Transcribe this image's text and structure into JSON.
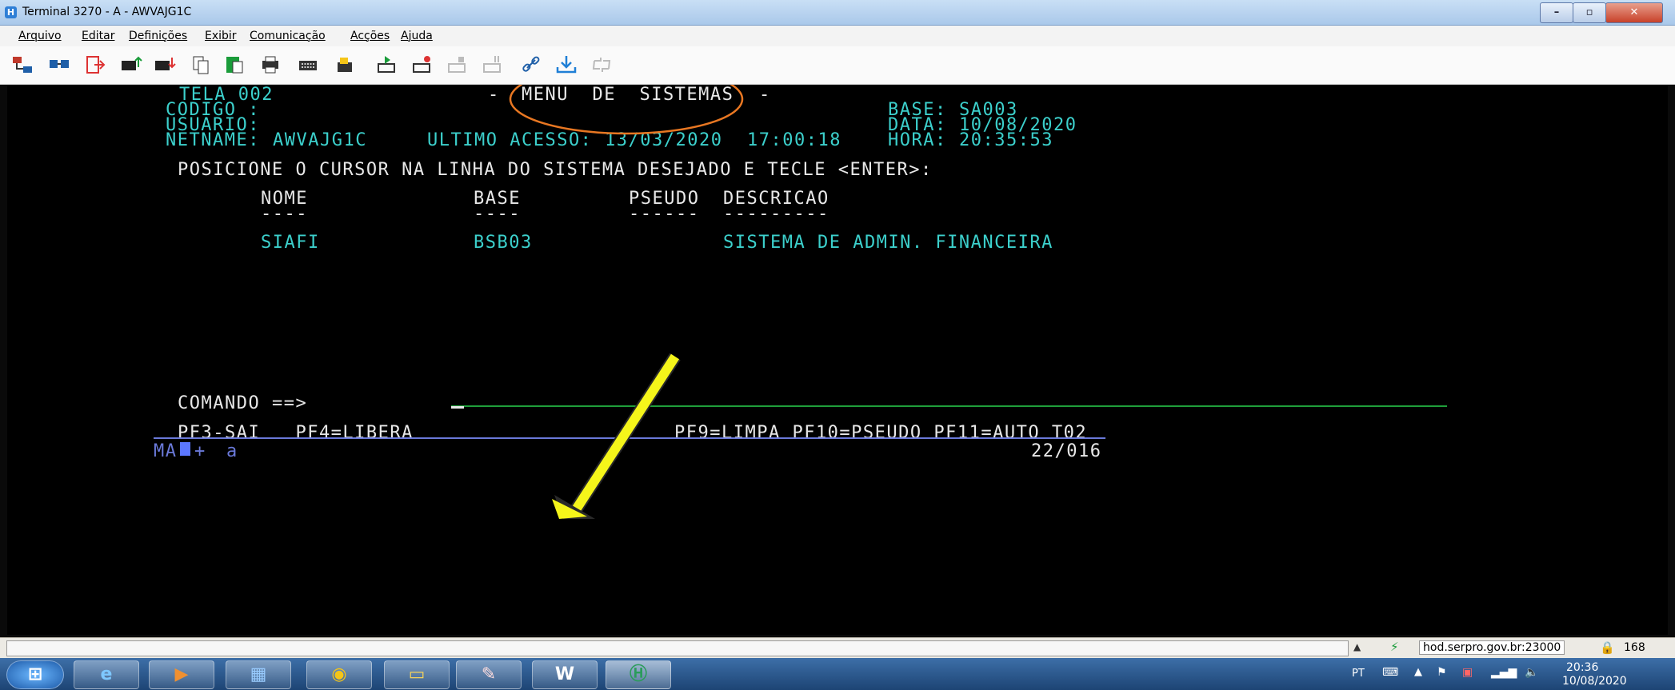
{
  "window": {
    "title": "Terminal 3270 - A - AWVAJG1C",
    "icon_letter": "H"
  },
  "menu": [
    "Arquivo",
    "Editar",
    "Definições",
    "Exibir",
    "Comunicação",
    "Acções",
    "Ajuda"
  ],
  "toolbar_icons": [
    "connect-icon",
    "disconnect-icon",
    "exit-icon",
    "send-icon",
    "receive-icon",
    "copy-icon",
    "paste-icon",
    "print-icon",
    "keyboard-icon",
    "macro-icon",
    "play-icon",
    "record-icon",
    "stop-icon",
    "pause-icon",
    "link-icon",
    "download-icon",
    "refresh-icon"
  ],
  "screen": {
    "tela": "TELA 002",
    "dash_left": "-",
    "menu_title": "MENU  DE  SISTEMAS",
    "dash_right": "-",
    "codigo": "CODIGO :",
    "usuario": "USUARIO:",
    "netname_label": "NETNAME:",
    "netname": "AWVAJG1C",
    "ultimo_label": "ULTIMO ACESSO:",
    "ultimo_data": "13/03/2020",
    "ultimo_hora": "17:00:18",
    "base_label": "BASE:",
    "base": "SA003",
    "data_label": "DATA:",
    "data": "10/08/2020",
    "hora_label": "HORA:",
    "hora": "20:35:53",
    "instruction": "POSICIONE O CURSOR NA LINHA DO SISTEMA DESEJADO E TECLE <ENTER>:",
    "headers": {
      "nome": "NOME",
      "base": "BASE",
      "pseudo": "PSEUDO",
      "descricao": "DESCRICAO"
    },
    "underlines": {
      "nome": "----",
      "base": "----",
      "pseudo": "------",
      "descricao": "---------"
    },
    "rows": [
      {
        "nome": "SIAFI",
        "base": "BSB03",
        "pseudo": "",
        "descricao": "SISTEMA DE ADMIN. FINANCEIRA"
      }
    ],
    "comando_label": "COMANDO ==>",
    "pf_left": "PF3-SAI   PF4=LIBERA",
    "pf_right": "PF9=LIMPA PF10=PSEUDO PF11=AUTO T02",
    "oia_ma": "MA",
    "oia_plus": "+",
    "oia_a": "a",
    "cursor_pos": "22/016"
  },
  "annotation": {
    "ellipse_color": "#e87722",
    "arrow_color": "#f5f51a"
  },
  "statusbar": {
    "host": "hod.serpro.gov.br:23000",
    "count": "168"
  },
  "taskbar": {
    "lang": "PT",
    "time": "20:36",
    "date": "10/08/2020",
    "apps": [
      "start-orb",
      "internet-explorer-icon",
      "media-player-icon",
      "network-icon",
      "chrome-icon",
      "file-explorer-icon",
      "paint-icon",
      "word-icon",
      "host-on-demand-icon"
    ]
  },
  "colors": {
    "terminal_text": "#3cd0cc",
    "terminal_bright": "#e8e8e8",
    "terminal_bg": "#000000",
    "field_line": "#1f9e3a",
    "oia_line": "#6a79d9"
  }
}
